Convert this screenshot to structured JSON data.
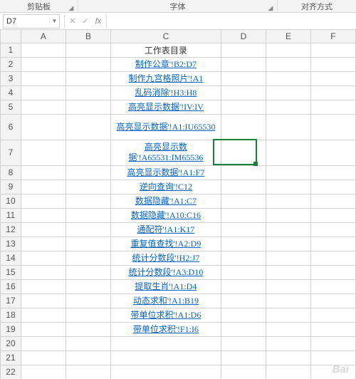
{
  "ribbon": {
    "groups": [
      "剪贴板",
      "字体",
      "对齐方式"
    ]
  },
  "formulaBar": {
    "nameBox": "D7",
    "cancel": "✕",
    "confirm": "✓",
    "fx": "fx",
    "formula": ""
  },
  "columns": [
    "A",
    "B",
    "C",
    "D",
    "E",
    "F"
  ],
  "rows": [
    1,
    2,
    3,
    4,
    5,
    6,
    7,
    8,
    9,
    10,
    11,
    12,
    13,
    14,
    15,
    16,
    17,
    18,
    19,
    20,
    21,
    22
  ],
  "cells": {
    "C": [
      "工作表目录",
      "制作公章'!B2:D7",
      "制作九宫格照片'!A1",
      "乱码消除'!H3:H8",
      "高亮显示数据'!IV:IV",
      "高亮显示数据'!A1:IU65530",
      "高亮显示数据'!A65531:IM65536",
      "高亮显示数据'!A1:F7",
      "逆向查询'!C12",
      "数据隐藏'!A1:C7",
      "数据隐藏'!A10:C16",
      "通配符'!A1:K17",
      "重复值查找'!A2:D9",
      "统计分数段'!H2:J7",
      "统计分数段'!A3:D10",
      "提取生肖'!A1:D4",
      "动态求和'!A1:B19",
      "带单位求积'!A1:D6",
      "带单位求积'!F1:I6",
      "",
      "",
      ""
    ]
  },
  "activeCell": "D7",
  "watermark": {
    "main": "Bai",
    "sub": ""
  }
}
